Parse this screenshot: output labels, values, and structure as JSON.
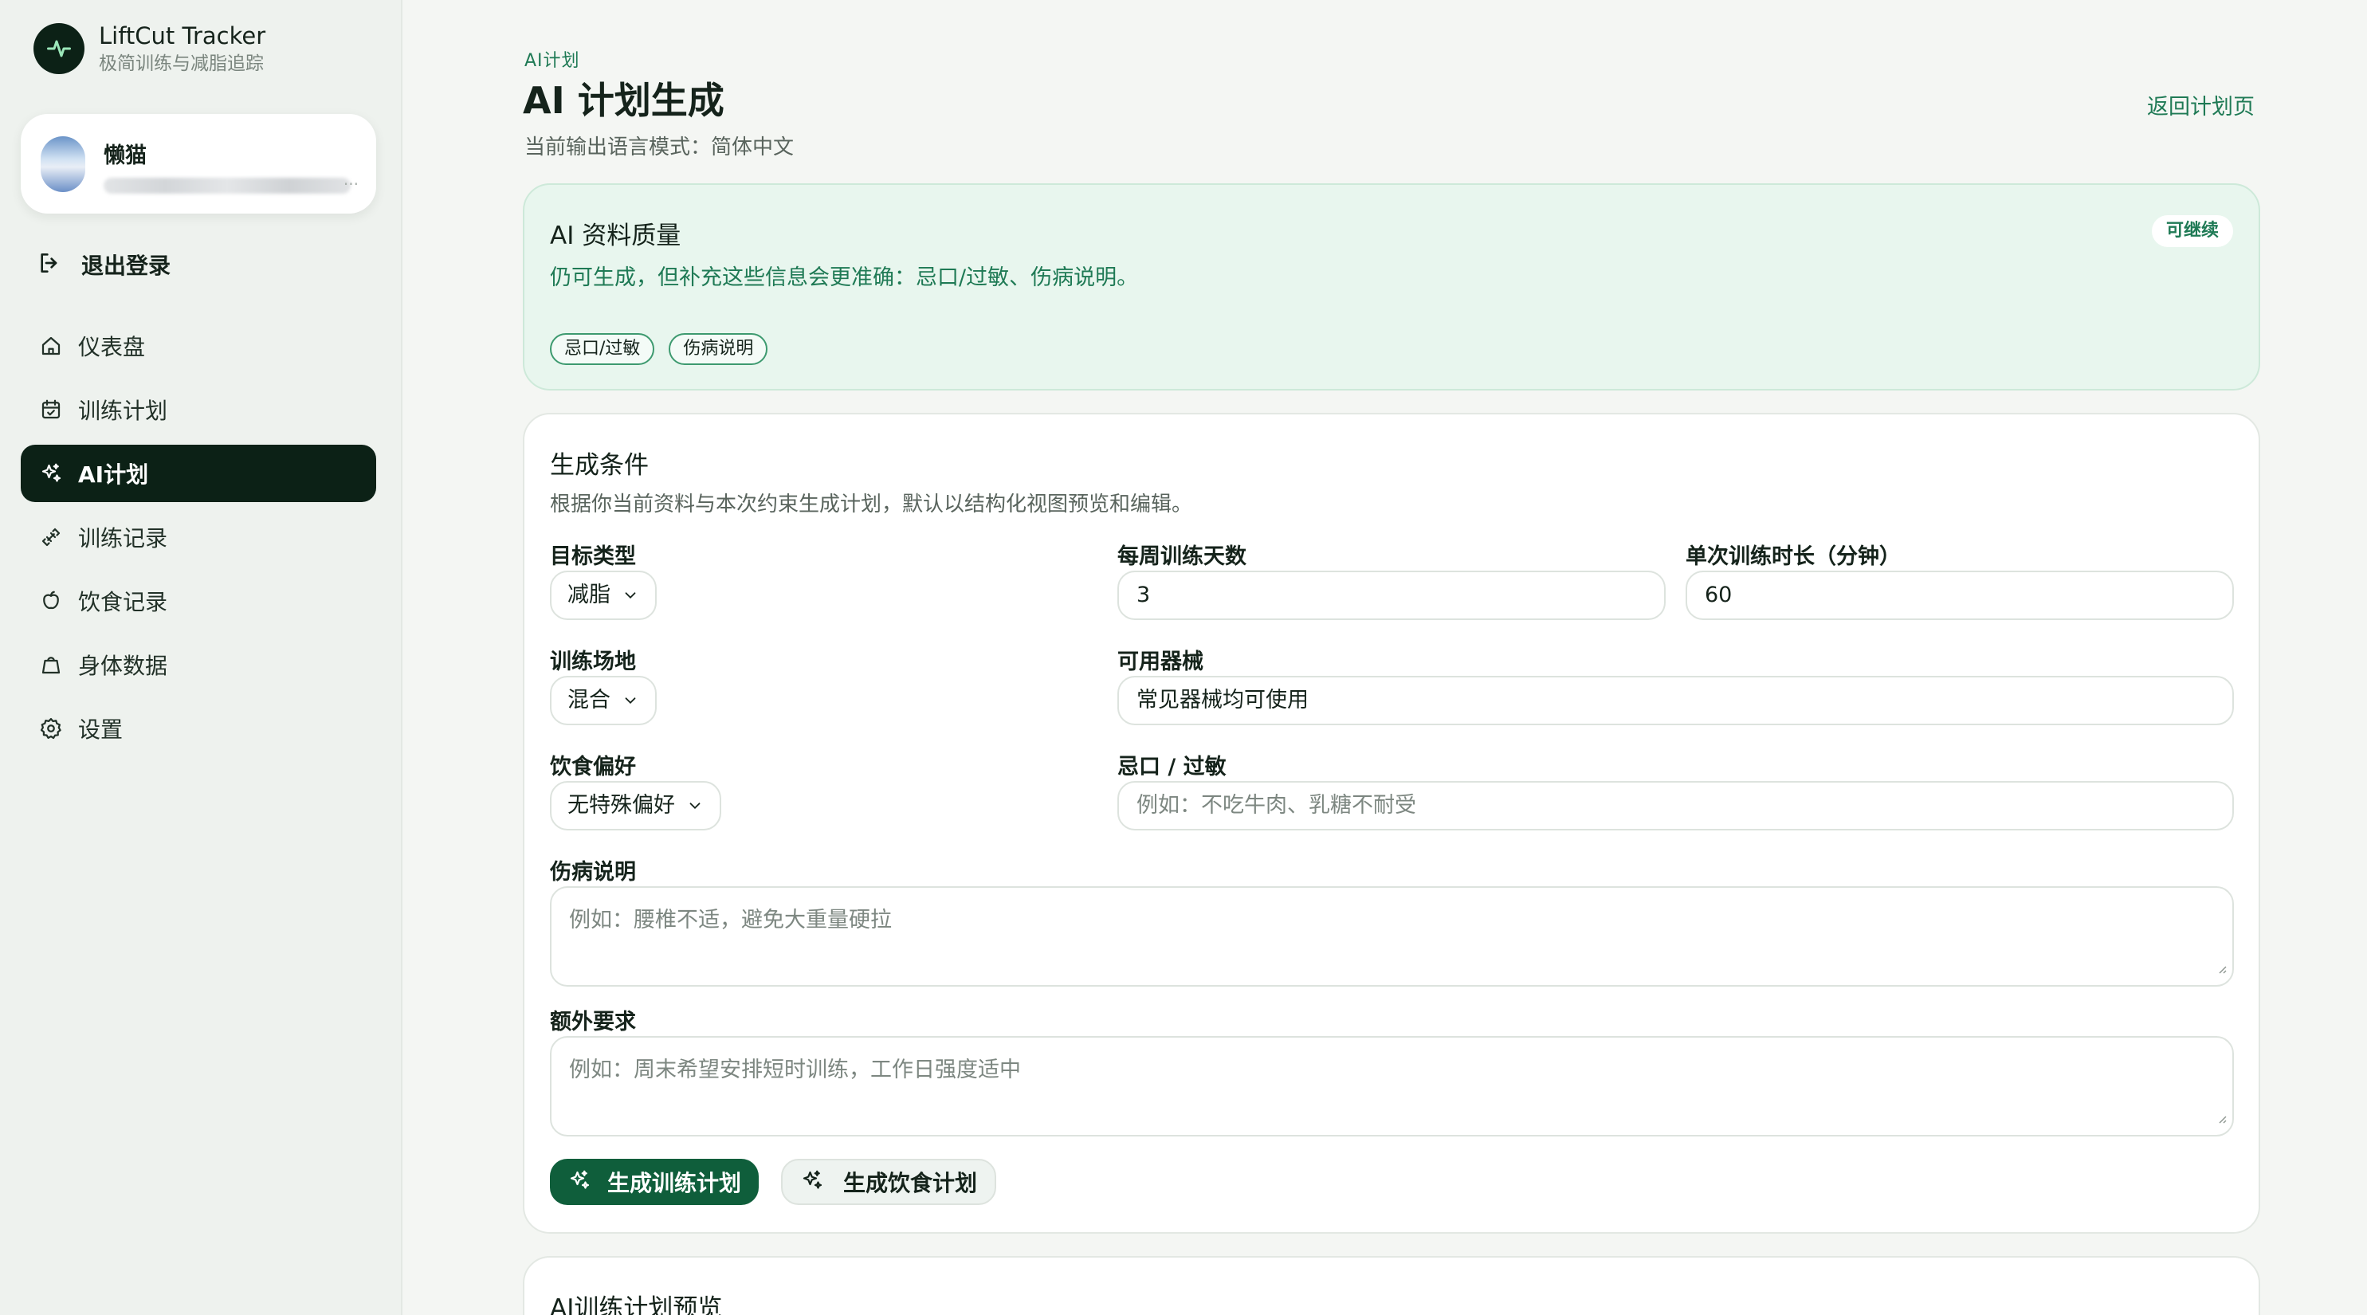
{
  "brand": {
    "name": "LiftCut Tracker",
    "subtitle": "极简训练与减脂追踪"
  },
  "user": {
    "name": "懒猫",
    "email": "..."
  },
  "logout_label": "退出登录",
  "nav": [
    {
      "label": "仪表盘",
      "icon": "home-icon"
    },
    {
      "label": "训练计划",
      "icon": "calendar-icon"
    },
    {
      "label": "AI计划",
      "icon": "sparkle-icon",
      "active": true
    },
    {
      "label": "训练记录",
      "icon": "dumbbell-icon"
    },
    {
      "label": "饮食记录",
      "icon": "apple-icon"
    },
    {
      "label": "身体数据",
      "icon": "body-icon"
    },
    {
      "label": "设置",
      "icon": "gear-icon"
    }
  ],
  "header": {
    "breadcrumb": "AI计划",
    "title": "AI 计划生成",
    "language_mode": "当前输出语言模式：简体中文",
    "back_link": "返回计划页"
  },
  "quality": {
    "title": "AI 资料质量",
    "description": "仍可生成，但补充这些信息会更准确：忌口/过敏、伤病说明。",
    "status_badge": "可继续",
    "missing_tags": [
      "忌口/过敏",
      "伤病说明"
    ]
  },
  "conditions": {
    "title": "生成条件",
    "description": "根据你当前资料与本次约束生成计划，默认以结构化视图预览和编辑。",
    "goal_type": {
      "label": "目标类型",
      "value": "减脂"
    },
    "days_per_week": {
      "label": "每周训练天数",
      "value": "3"
    },
    "session_minutes": {
      "label": "单次训练时长（分钟）",
      "value": "60"
    },
    "venue": {
      "label": "训练场地",
      "value": "混合"
    },
    "equipment": {
      "label": "可用器械",
      "value": "常见器械均可使用"
    },
    "diet_pref": {
      "label": "饮食偏好",
      "value": "无特殊偏好"
    },
    "allergies": {
      "label": "忌口 / 过敏",
      "placeholder": "例如：不吃牛肉、乳糖不耐受"
    },
    "injuries": {
      "label": "伤病说明",
      "placeholder": "例如：腰椎不适，避免大重量硬拉"
    },
    "extra": {
      "label": "额外要求",
      "placeholder": "例如：周末希望安排短时训练，工作日强度适中"
    },
    "generate_training_label": "生成训练计划",
    "generate_diet_label": "生成饮食计划"
  },
  "preview": {
    "title": "AI训练计划预览"
  },
  "colors": {
    "accent": "#1f7a55",
    "dark": "#0c2116",
    "button": "#0f5e3b"
  }
}
